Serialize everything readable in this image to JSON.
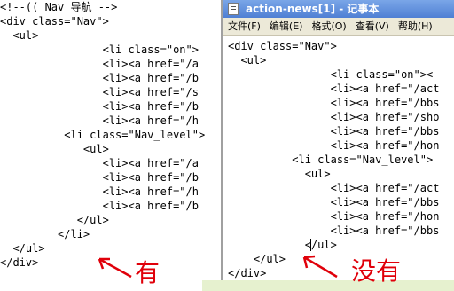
{
  "left_code": [
    "<!--(( Nav 导航 -->",
    "<div class=\"Nav\">",
    "  <ul>",
    "                <li class=\"on\">",
    "                <li><a href=\"/a",
    "                <li><a href=\"/b",
    "                <li><a href=\"/s",
    "                <li><a href=\"/b",
    "                <li><a href=\"/h",
    "          <li class=\"Nav_level\">",
    "             <ul>",
    "                <li><a href=\"/a",
    "                <li><a href=\"/b",
    "                <li><a href=\"/h",
    "                <li><a href=\"/b",
    "            </ul>",
    "         </li>",
    "  </ul>",
    "</div>"
  ],
  "window": {
    "title": "action-news[1] - 记事本",
    "menu": [
      "文件(F)",
      "编辑(E)",
      "格式(O)",
      "查看(V)",
      "帮助(H)"
    ]
  },
  "right_code": [
    "<div class=\"Nav\">",
    "  <ul>",
    "                <li class=\"on\"><",
    "                <li><a href=\"/act",
    "                <li><a href=\"/bbs",
    "                <li><a href=\"/sho",
    "                <li><a href=\"/bbs",
    "                <li><a href=\"/hon",
    "          <li class=\"Nav_level\">",
    "            <ul>",
    "                <li><a href=\"/act",
    "                <li><a href=\"/bbs",
    "                <li><a href=\"/hon",
    "                <li><a href=\"/bbs",
    "            </ul>",
    "    </ul>",
    "</div>"
  ],
  "annotations": {
    "left_note": "有",
    "right_note": "没有"
  },
  "colors": {
    "annotation": "#e0000a",
    "titlebar": "#4f7fd4",
    "menubar": "#ece9d8"
  }
}
